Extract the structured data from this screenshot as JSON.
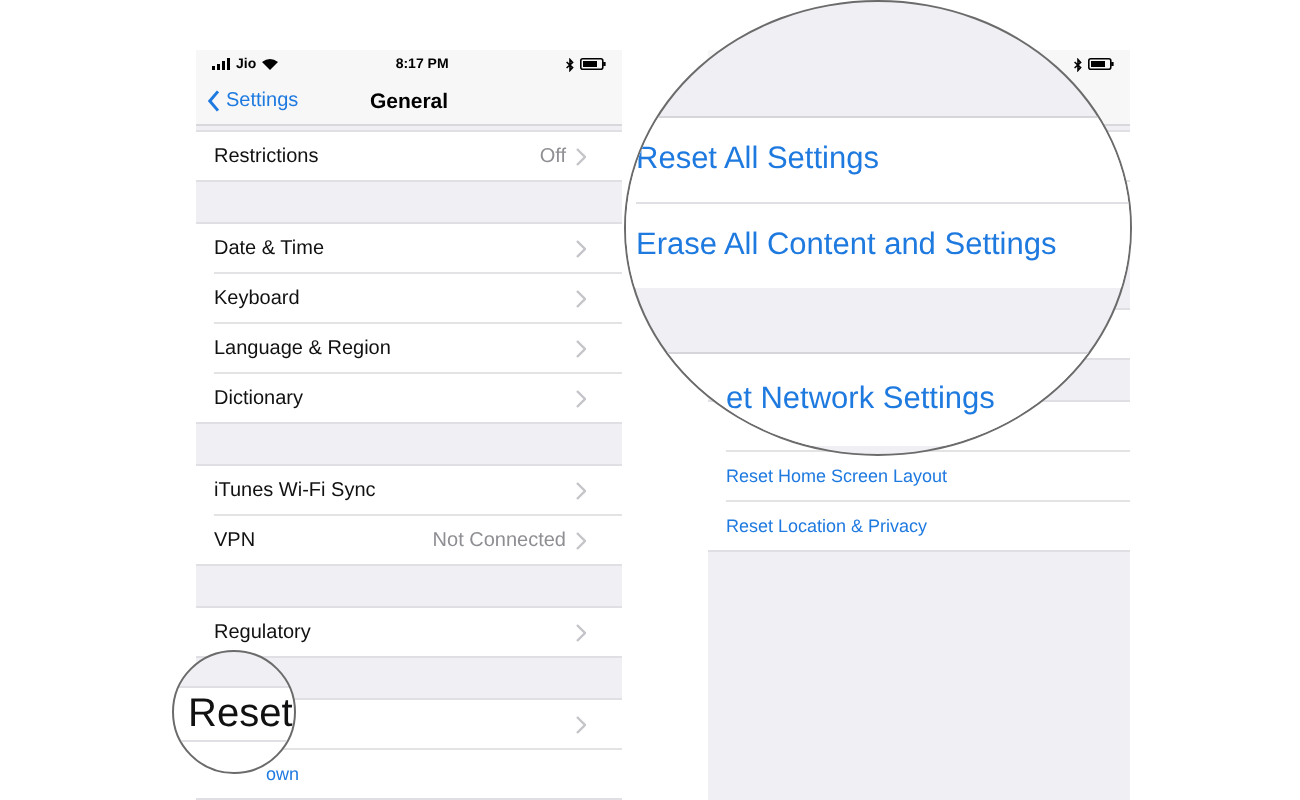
{
  "left_phone": {
    "status_bar": {
      "carrier": "Jio",
      "time": "8:17 PM"
    },
    "nav_bar": {
      "back": "Settings",
      "title": "General"
    },
    "groups": [
      {
        "rows": [
          {
            "kind": "disclosure",
            "label": "Restrictions",
            "value": "Off"
          }
        ]
      },
      {
        "rows": [
          {
            "kind": "disclosure",
            "label": "Date & Time"
          },
          {
            "kind": "disclosure",
            "label": "Keyboard"
          },
          {
            "kind": "disclosure",
            "label": "Language & Region"
          },
          {
            "kind": "disclosure",
            "label": "Dictionary"
          }
        ]
      },
      {
        "rows": [
          {
            "kind": "disclosure",
            "label": "iTunes Wi-Fi Sync"
          },
          {
            "kind": "disclosure",
            "label": "VPN",
            "value": "Not Connected"
          }
        ]
      },
      {
        "rows": [
          {
            "kind": "disclosure",
            "label": "Regulatory"
          }
        ]
      },
      {
        "rows": [
          {
            "kind": "disclosure"
          },
          {
            "kind": "action_covered",
            "label": "own"
          }
        ]
      }
    ]
  },
  "reset_magnifier": {
    "label": "Reset"
  },
  "right_phone": {
    "groups": [
      {
        "rows": [
          {
            "kind": "blank"
          },
          {
            "kind": "blank"
          }
        ]
      },
      {
        "rows": [
          {
            "kind": "blank"
          }
        ]
      },
      {
        "rows": [
          {
            "kind": "blank"
          },
          {
            "kind": "action",
            "label": "Reset Home Screen Layout"
          },
          {
            "kind": "action",
            "label": "Reset Location & Privacy"
          }
        ]
      }
    ]
  },
  "settings_magnifier": {
    "rows": [
      {
        "kind": "action",
        "label": "Reset All Settings"
      },
      {
        "kind": "action",
        "label": "Erase All Content and Settings"
      },
      {
        "kind": "gap"
      },
      {
        "kind": "action_covered",
        "label": "et Network Settings"
      }
    ]
  }
}
